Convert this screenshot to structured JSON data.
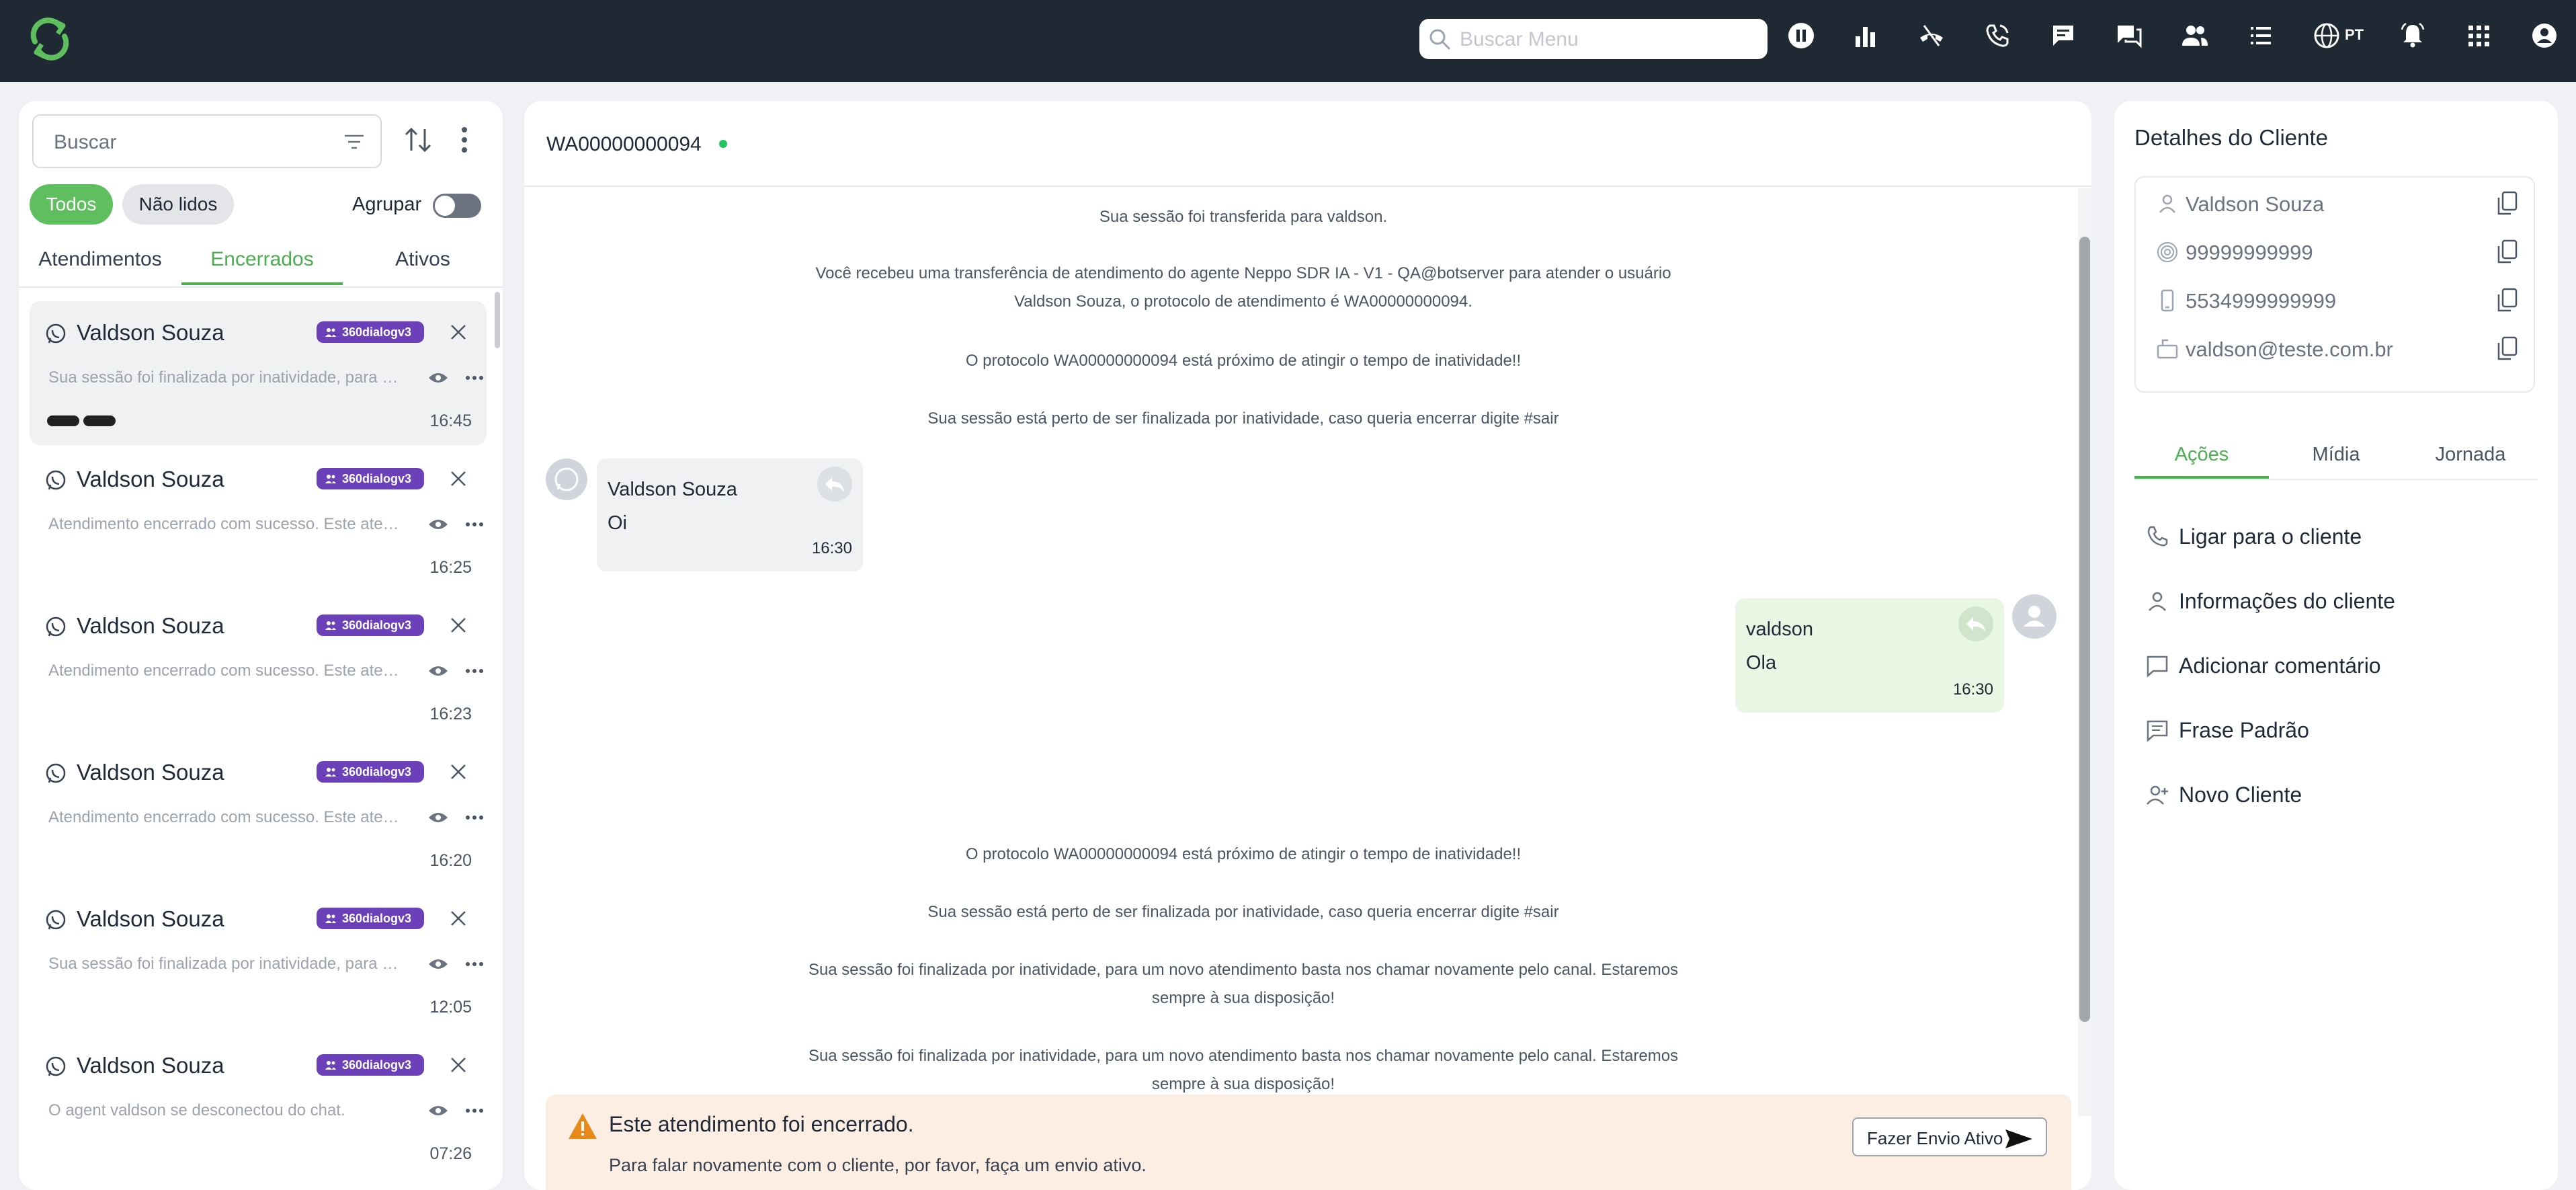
{
  "header": {
    "menu_search_placeholder": "Buscar Menu",
    "language_label": "PT",
    "icons": [
      "pause-icon",
      "stats-icon",
      "hangup-icon",
      "call-icon",
      "chat-icon",
      "chats-icon",
      "users-icon",
      "list-icon",
      "globe-icon",
      "bell-icon",
      "apps-icon",
      "account-icon"
    ]
  },
  "sidebar": {
    "search_placeholder": "Buscar",
    "filters": {
      "all": "Todos",
      "unread": "Não lidos"
    },
    "group_label": "Agrupar",
    "group_enabled": false,
    "tabs": [
      "Atendimentos",
      "Encerrados",
      "Ativos"
    ],
    "active_tab": "Encerrados",
    "conversations": [
      {
        "name": "Valdson Souza",
        "badge": "360dialogv3",
        "preview": "Sua sessão foi finalizada por inatividade, para um novo atendimento basta nos chamar",
        "time": "16:45",
        "selected": true
      },
      {
        "name": "Valdson Souza",
        "badge": "360dialogv3",
        "preview": "Atendimento encerrado com sucesso. Este atendimento foi finalizado",
        "time": "16:25"
      },
      {
        "name": "Valdson Souza",
        "badge": "360dialogv3",
        "preview": "Atendimento encerrado com sucesso. Este atendimento foi finalizado",
        "time": "16:23"
      },
      {
        "name": "Valdson Souza",
        "badge": "360dialogv3",
        "preview": "Atendimento encerrado com sucesso. Este atendimento foi finalizado",
        "time": "16:20"
      },
      {
        "name": "Valdson Souza",
        "badge": "360dialogv3",
        "preview": "Sua sessão foi finalizada por inatividade, para um novo atendimento basta nos chamar",
        "time": "12:05"
      },
      {
        "name": "Valdson Souza",
        "badge": "360dialogv3",
        "preview": "O agent valdson se desconectou do chat.",
        "time": "07:26"
      }
    ]
  },
  "chat": {
    "protocol": "WA00000000094",
    "system_messages": [
      "Sua sessão foi transferida para valdson.",
      "Você recebeu uma transferência de atendimento do agente Neppo SDR IA - V1 - QA@botserver para atender o usuário Valdson Souza, o protocolo de atendimento é WA00000000094.",
      "O protocolo WA00000000094 está próximo de atingir o tempo de inatividade!!",
      "Sua sessão está perto de ser finalizada por inatividade, caso queria encerrar digite #sair",
      "O protocolo WA00000000094 está próximo de atingir o tempo de inatividade!!",
      "Sua sessão está perto de ser finalizada por inatividade, caso queria encerrar digite #sair",
      "Sua sessão foi finalizada por inatividade, para um novo atendimento basta nos chamar novamente pelo canal. Estaremos sempre à sua disposição!",
      "Sua sessão foi finalizada por inatividade, para um novo atendimento basta nos chamar novamente pelo canal. Estaremos sempre à sua disposição!"
    ],
    "incoming": {
      "sender": "Valdson Souza",
      "text": "Oi",
      "time": "16:30"
    },
    "outgoing": {
      "sender": "valdson",
      "text": "Ola",
      "time": "16:30"
    },
    "closed_banner": {
      "title": "Este atendimento foi encerrado.",
      "subtitle": "Para falar novamente com o cliente, por favor, faça um envio ativo.",
      "button": "Fazer Envio Ativo"
    }
  },
  "client": {
    "title": "Detalhes do Cliente",
    "name": "Valdson Souza",
    "document": "99999999999",
    "phone": "5534999999999",
    "email": "valdson@teste.com.br",
    "tabs": [
      "Ações",
      "Mídia",
      "Jornada"
    ],
    "active_tab": "Ações",
    "actions": [
      "Ligar para o cliente",
      "Informações do cliente",
      "Adicionar comentário",
      "Frase Padrão",
      "Novo Cliente"
    ]
  },
  "colors": {
    "accent": "#4caf50",
    "topbar": "#1f2933",
    "badge": "#6b40b8",
    "banner": "#fdeee4",
    "warning": "#e88a1a"
  }
}
